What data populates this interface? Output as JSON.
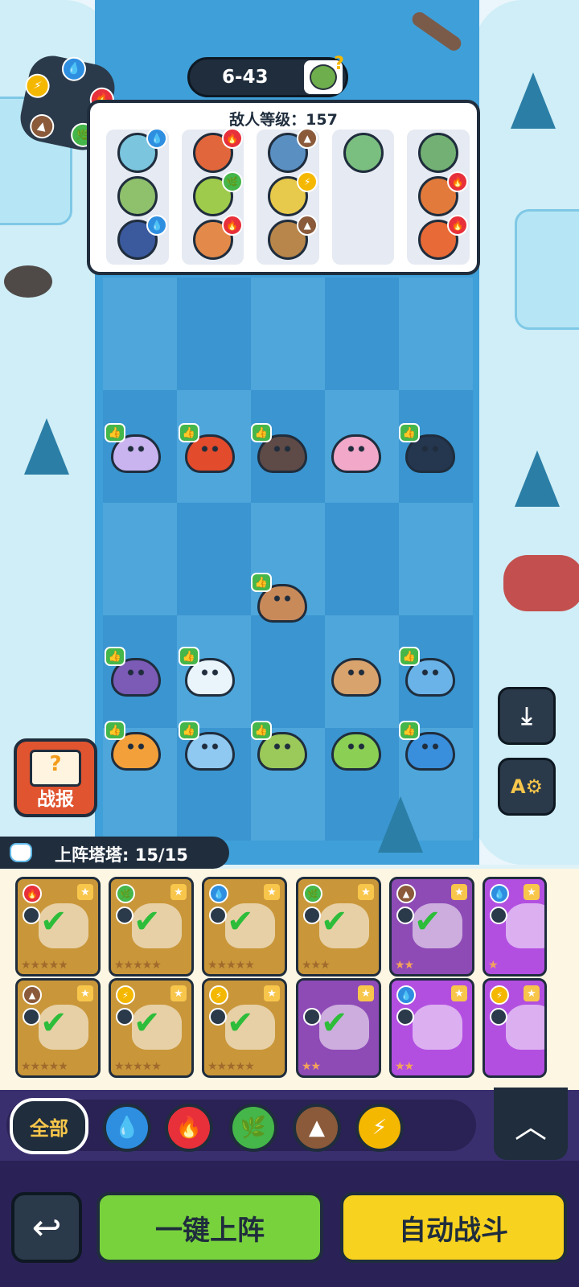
{
  "colors": {
    "water": "#2e8ee0",
    "fire": "#e8303a",
    "grass": "#45b649",
    "earth": "#8a5a3a",
    "electric": "#f5b800"
  },
  "hud": {
    "stage": "6-43",
    "enemy_level_label": "敌人等级：157"
  },
  "enemy_columns": [
    {
      "enemies": [
        {
          "face": "#7bc5de",
          "element": "water",
          "icon": "💧"
        },
        {
          "face": "#8fc06c",
          "element": "",
          "icon": ""
        },
        {
          "face": "#3b5a9e",
          "element": "water",
          "icon": "💧"
        }
      ]
    },
    {
      "enemies": [
        {
          "face": "#e2663b",
          "element": "fire",
          "icon": "🔥"
        },
        {
          "face": "#9ecb4b",
          "element": "grass",
          "icon": "🌿"
        },
        {
          "face": "#e38a4b",
          "element": "fire",
          "icon": "🔥"
        }
      ]
    },
    {
      "enemies": [
        {
          "face": "#5a8fc2",
          "element": "earth",
          "icon": "▲"
        },
        {
          "face": "#e7c94b",
          "element": "electric",
          "icon": "⚡"
        },
        {
          "face": "#b8864a",
          "element": "earth",
          "icon": "▲"
        }
      ]
    },
    {
      "enemies": [
        {
          "face": "#7bbf80",
          "element": "",
          "icon": ""
        }
      ]
    },
    {
      "enemies": [
        {
          "face": "#72b173",
          "element": "",
          "icon": ""
        },
        {
          "face": "#e27a3b",
          "element": "fire",
          "icon": "🔥"
        },
        {
          "face": "#e86a36",
          "element": "fire",
          "icon": "🔥"
        }
      ]
    }
  ],
  "board_units": [
    {
      "name": "purple-fox",
      "color": "#c9b4f0",
      "col": 0,
      "row": 0
    },
    {
      "name": "fire-beast",
      "color": "#e24b2b",
      "col": 1,
      "row": 0
    },
    {
      "name": "rock-dino",
      "color": "#5e4a46",
      "col": 2,
      "row": 0
    },
    {
      "name": "pink-mantis",
      "color": "#f2a8c8",
      "col": 3,
      "row": 0,
      "no_thumb": true
    },
    {
      "name": "penguin",
      "color": "#25364f",
      "col": 4,
      "row": 0
    },
    {
      "name": "sloth",
      "color": "#c98a5a",
      "col": 2,
      "row": 2
    },
    {
      "name": "purple-bull",
      "color": "#7b5bb6",
      "col": 0,
      "row": 3
    },
    {
      "name": "robo-cat",
      "color": "#e9f4fb",
      "col": 1,
      "row": 3
    },
    {
      "name": "snail",
      "color": "#d9a36d",
      "col": 3,
      "row": 3,
      "no_thumb": true
    },
    {
      "name": "octopus",
      "color": "#6ab3e8",
      "col": 4,
      "row": 3
    },
    {
      "name": "lion",
      "color": "#f3a03a",
      "col": 0,
      "row": 4
    },
    {
      "name": "water-spirit",
      "color": "#8fc8f0",
      "col": 1,
      "row": 4
    },
    {
      "name": "berry-cat",
      "color": "#9bc95a",
      "col": 2,
      "row": 4
    },
    {
      "name": "sprout",
      "color": "#8bcf55",
      "col": 3,
      "row": 4,
      "no_thumb": true
    },
    {
      "name": "blue-dragon",
      "color": "#3a8fdc",
      "col": 4,
      "row": 4
    }
  ],
  "buttons": {
    "report": "战报",
    "report_badge": "?",
    "filter_all": "全部",
    "deploy": "一键上阵",
    "auto_battle": "自动战斗"
  },
  "roster": {
    "label": "上阵塔塔: 15/15",
    "rows": [
      [
        {
          "style": "gold",
          "element": "fire",
          "icon": "🔥",
          "stars": "★★★★★",
          "checked": true
        },
        {
          "style": "gold",
          "element": "grass",
          "icon": "🌿",
          "stars": "★★★★★",
          "checked": true
        },
        {
          "style": "gold",
          "element": "water",
          "icon": "💧",
          "stars": "★★★★★",
          "checked": true
        },
        {
          "style": "gold",
          "element": "grass",
          "icon": "🌿",
          "stars": "★★★",
          "checked": true
        },
        {
          "style": "purple",
          "element": "earth",
          "icon": "▲",
          "stars": "★★",
          "checked": true
        },
        {
          "style": "violet",
          "element": "water",
          "icon": "💧",
          "stars": "★",
          "checked": false
        }
      ],
      [
        {
          "style": "gold",
          "element": "earth",
          "icon": "▲",
          "stars": "★★★★★",
          "checked": true
        },
        {
          "style": "gold",
          "element": "electric",
          "icon": "⚡",
          "stars": "★★★★★",
          "checked": true
        },
        {
          "style": "gold",
          "element": "electric",
          "icon": "⚡",
          "stars": "★★★★★",
          "checked": true
        },
        {
          "style": "purple",
          "element": "",
          "icon": "",
          "stars": "★★",
          "checked": true
        },
        {
          "style": "violet",
          "element": "water",
          "icon": "💧",
          "stars": "★★",
          "checked": false
        },
        {
          "style": "violet",
          "element": "electric",
          "icon": "⚡",
          "stars": "",
          "checked": false
        }
      ]
    ]
  },
  "filters": [
    {
      "name": "water",
      "icon": "💧"
    },
    {
      "name": "fire",
      "icon": "🔥"
    },
    {
      "name": "grass",
      "icon": "🌿"
    },
    {
      "name": "earth",
      "icon": "▲"
    },
    {
      "name": "electric",
      "icon": "⚡"
    }
  ],
  "side_buttons": [
    {
      "name": "download",
      "icon": "⤓"
    },
    {
      "name": "auto-settings",
      "icon": "A⚙"
    }
  ]
}
